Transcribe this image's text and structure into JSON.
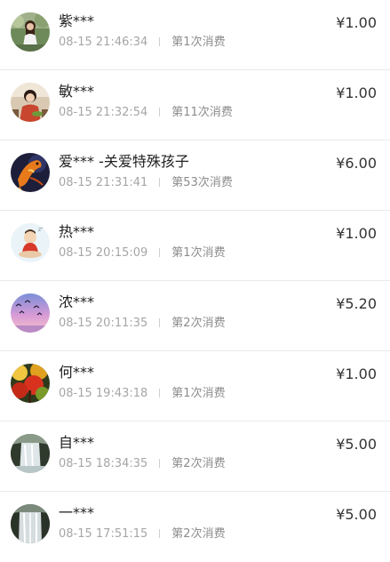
{
  "donations": [
    {
      "name": "紫***",
      "time": "08-15 21:46:34",
      "count": "第1次消费",
      "amount": "¥1.00",
      "avatar_icon": "woman-photo-icon"
    },
    {
      "name": "敏***",
      "time": "08-15 21:32:54",
      "count": "第11次消费",
      "amount": "¥1.00",
      "avatar_icon": "woman-sofa-photo-icon"
    },
    {
      "name": "爱*** -关爱特殊孩子",
      "time": "08-15 21:31:41",
      "count": "第53次消费",
      "amount": "¥6.00",
      "avatar_icon": "koi-fish-icon"
    },
    {
      "name": "热***",
      "time": "08-15 20:15:09",
      "count": "第1次消费",
      "amount": "¥1.00",
      "avatar_icon": "cartoon-meditation-icon"
    },
    {
      "name": "浓***",
      "time": "08-15 20:11:35",
      "count": "第2次消费",
      "amount": "¥5.20",
      "avatar_icon": "sunset-birds-icon"
    },
    {
      "name": "何***",
      "time": "08-15 19:43:18",
      "count": "第1次消费",
      "amount": "¥1.00",
      "avatar_icon": "autumn-leaves-icon"
    },
    {
      "name": "自***",
      "time": "08-15 18:34:35",
      "count": "第2次消费",
      "amount": "¥5.00",
      "avatar_icon": "waterfall-icon"
    },
    {
      "name": "一***",
      "time": "08-15 17:51:15",
      "count": "第2次消费",
      "amount": "¥5.00",
      "avatar_icon": "waterfall-icon"
    }
  ]
}
